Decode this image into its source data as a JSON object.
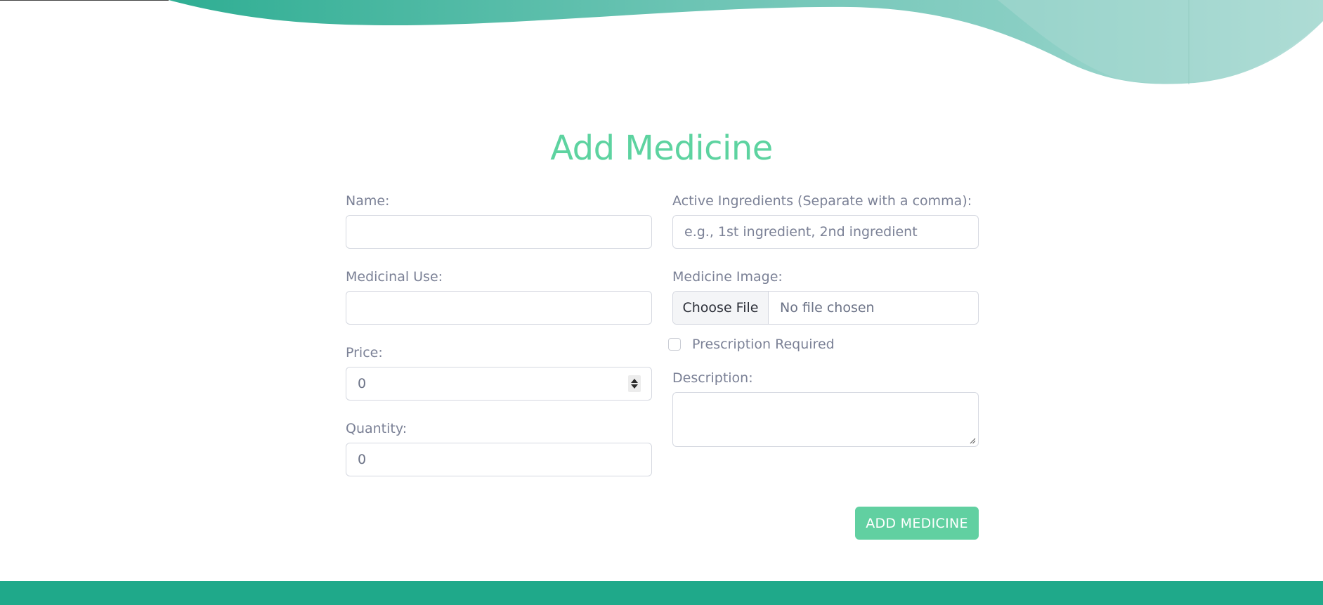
{
  "page": {
    "title": "Add Medicine"
  },
  "form": {
    "name": {
      "label": "Name:",
      "value": ""
    },
    "medicinal_use": {
      "label": "Medicinal Use:",
      "value": ""
    },
    "price": {
      "label": "Price:",
      "value": "0"
    },
    "quantity": {
      "label": "Quantity:",
      "value": "0"
    },
    "active_ingredients": {
      "label": "Active Ingredients (Separate with a comma):",
      "placeholder": "e.g., 1st ingredient, 2nd ingredient",
      "value": ""
    },
    "medicine_image": {
      "label": "Medicine Image:",
      "button_label": "Choose File",
      "status": "No file chosen"
    },
    "prescription_required": {
      "label": "Prescription Required",
      "checked": false
    },
    "description": {
      "label": "Description:",
      "value": ""
    },
    "submit_label": "ADD MEDICINE"
  },
  "colors": {
    "accent": "#5dd3a0",
    "button": "#61d0a1",
    "footer": "#1fa98a",
    "label": "#7b8196"
  },
  "icons": {
    "spinner": "number-spinner-icon",
    "resize": "resize-grip-icon"
  }
}
